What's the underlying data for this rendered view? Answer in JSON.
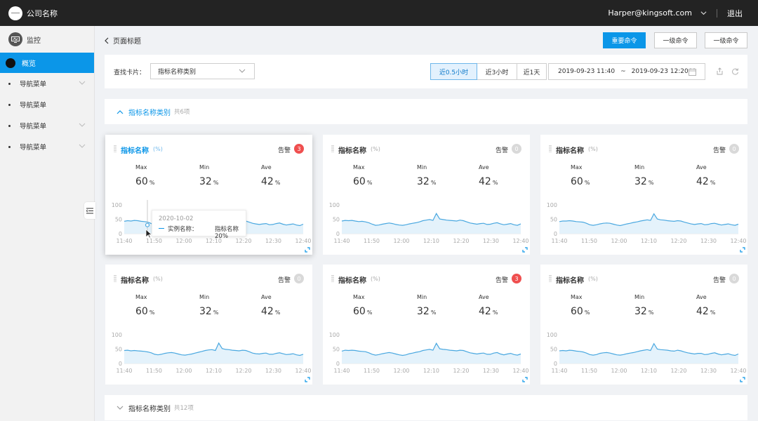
{
  "header": {
    "company": "公司名称",
    "user": "Harper@kingsoft.com",
    "logout": "退出"
  },
  "sidebar": {
    "title": "监控",
    "active": "概览",
    "items": [
      {
        "label": "导航菜单",
        "expandable": true
      },
      {
        "label": "导航菜单",
        "expandable": false
      },
      {
        "label": "导航菜单",
        "expandable": true
      },
      {
        "label": "导航菜单",
        "expandable": true
      }
    ]
  },
  "page": {
    "title": "页面标题",
    "primary_button": "重要命令",
    "secondary_button_1": "一级命令",
    "secondary_button_2": "一级命令"
  },
  "filter": {
    "label": "查找卡片：",
    "select_value": "指标名称类别",
    "ranges": [
      "近0.5小时",
      "近3小时",
      "近1天"
    ],
    "active_range": "近0.5小时",
    "date_start": "2019-09-23 11:40",
    "date_sep": "~",
    "date_end": "2019-09-23 12:20"
  },
  "group1": {
    "title": "指标名称类别",
    "count": "共6项",
    "expanded": true
  },
  "group2": {
    "title": "指标名称类别",
    "count": "共12项",
    "expanded": false
  },
  "cards": [
    {
      "title": "指标名称",
      "unit": "(%)",
      "alarm_label": "告警",
      "alarm_count": "3",
      "alarm_color": "#ef4f4f",
      "max_label": "Max",
      "max": "60",
      "min_label": "Min",
      "min": "32",
      "ave_label": "Ave",
      "ave": "42",
      "value_unit": "%"
    },
    {
      "title": "指标名称",
      "unit": "(%)",
      "alarm_label": "告警",
      "alarm_count": "0",
      "alarm_color": "#d9d9d9",
      "max_label": "Max",
      "max": "60",
      "min_label": "Min",
      "min": "32",
      "ave_label": "Ave",
      "ave": "42",
      "value_unit": "%"
    },
    {
      "title": "指标名称",
      "unit": "(%)",
      "alarm_label": "告警",
      "alarm_count": "0",
      "alarm_color": "#d9d9d9",
      "max_label": "Max",
      "max": "60",
      "min_label": "Min",
      "min": "32",
      "ave_label": "Ave",
      "ave": "42",
      "value_unit": "%"
    },
    {
      "title": "指标名称",
      "unit": "(%)",
      "alarm_label": "告警",
      "alarm_count": "0",
      "alarm_color": "#d9d9d9",
      "max_label": "Max",
      "max": "60",
      "min_label": "Min",
      "min": "32",
      "ave_label": "Ave",
      "ave": "42",
      "value_unit": "%"
    },
    {
      "title": "指标名称",
      "unit": "(%)",
      "alarm_label": "告警",
      "alarm_count": "3",
      "alarm_color": "#ef4f4f",
      "max_label": "Max",
      "max": "60",
      "min_label": "Min",
      "min": "32",
      "ave_label": "Ave",
      "ave": "42",
      "value_unit": "%"
    },
    {
      "title": "指标名称",
      "unit": "(%)",
      "alarm_label": "告警",
      "alarm_count": "0",
      "alarm_color": "#d9d9d9",
      "max_label": "Max",
      "max": "60",
      "min_label": "Min",
      "min": "32",
      "ave_label": "Ave",
      "ave": "42",
      "value_unit": "%"
    }
  ],
  "chart_data": {
    "type": "area",
    "x_ticks": [
      "11:40",
      "11:50",
      "12:00",
      "12:10",
      "12:20",
      "12:30",
      "12:40"
    ],
    "y_ticks": [
      0,
      50,
      100
    ],
    "ylim": [
      0,
      100
    ],
    "line_color": "#4aa8e0",
    "fill_color": "#e4f2fb",
    "series": [
      {
        "values": [
          43,
          45,
          44,
          46,
          45,
          43,
          42,
          40,
          35,
          30,
          28,
          31,
          34,
          36,
          38,
          36,
          32,
          29,
          28,
          30,
          33,
          35,
          38,
          40,
          44,
          46,
          48,
          45,
          68,
          50,
          48,
          47,
          46,
          44,
          43,
          46,
          44,
          40,
          36,
          34,
          32,
          34,
          35,
          31,
          32,
          35,
          37,
          33,
          30,
          32,
          34,
          30,
          28,
          33
        ]
      },
      {
        "values": [
          44,
          46,
          45,
          46,
          44,
          42,
          43,
          41,
          38,
          33,
          29,
          30,
          33,
          35,
          37,
          35,
          32,
          30,
          29,
          31,
          34,
          36,
          38,
          41,
          45,
          47,
          49,
          46,
          70,
          51,
          49,
          47,
          46,
          45,
          44,
          47,
          45,
          41,
          37,
          35,
          33,
          35,
          36,
          32,
          33,
          36,
          38,
          34,
          31,
          33,
          35,
          31,
          29,
          34
        ]
      },
      {
        "values": [
          42,
          44,
          44,
          45,
          44,
          42,
          41,
          40,
          36,
          31,
          29,
          31,
          34,
          36,
          37,
          36,
          33,
          30,
          28,
          31,
          34,
          36,
          39,
          41,
          44,
          46,
          48,
          46,
          69,
          51,
          48,
          47,
          45,
          44,
          43,
          45,
          44,
          40,
          37,
          34,
          32,
          34,
          35,
          31,
          32,
          35,
          36,
          33,
          30,
          32,
          34,
          31,
          29,
          33
        ]
      },
      {
        "values": [
          45,
          46,
          44,
          45,
          44,
          43,
          42,
          40,
          37,
          32,
          30,
          32,
          35,
          37,
          38,
          36,
          33,
          30,
          29,
          31,
          33,
          36,
          39,
          42,
          45,
          47,
          48,
          45,
          71,
          52,
          49,
          48,
          46,
          45,
          44,
          46,
          45,
          41,
          36,
          34,
          33,
          35,
          36,
          32,
          32,
          35,
          37,
          34,
          31,
          32,
          34,
          30,
          28,
          32
        ]
      },
      {
        "values": [
          43,
          46,
          45,
          46,
          45,
          43,
          42,
          41,
          37,
          32,
          29,
          31,
          34,
          36,
          38,
          36,
          33,
          30,
          28,
          30,
          34,
          36,
          39,
          41,
          45,
          47,
          49,
          46,
          70,
          51,
          49,
          48,
          46,
          45,
          44,
          46,
          45,
          41,
          37,
          35,
          33,
          35,
          36,
          32,
          32,
          36,
          38,
          33,
          30,
          33,
          35,
          31,
          29,
          33
        ]
      },
      {
        "values": [
          44,
          45,
          44,
          46,
          45,
          43,
          42,
          40,
          36,
          31,
          29,
          31,
          35,
          37,
          38,
          36,
          33,
          30,
          29,
          31,
          34,
          36,
          38,
          41,
          44,
          46,
          48,
          45,
          69,
          50,
          48,
          47,
          46,
          44,
          43,
          46,
          44,
          40,
          37,
          35,
          33,
          35,
          35,
          31,
          32,
          35,
          37,
          33,
          30,
          32,
          34,
          30,
          28,
          33
        ]
      }
    ]
  },
  "tooltip": {
    "date": "2020-10-02",
    "series": "实例名称：",
    "value": "指标名称 20%"
  }
}
